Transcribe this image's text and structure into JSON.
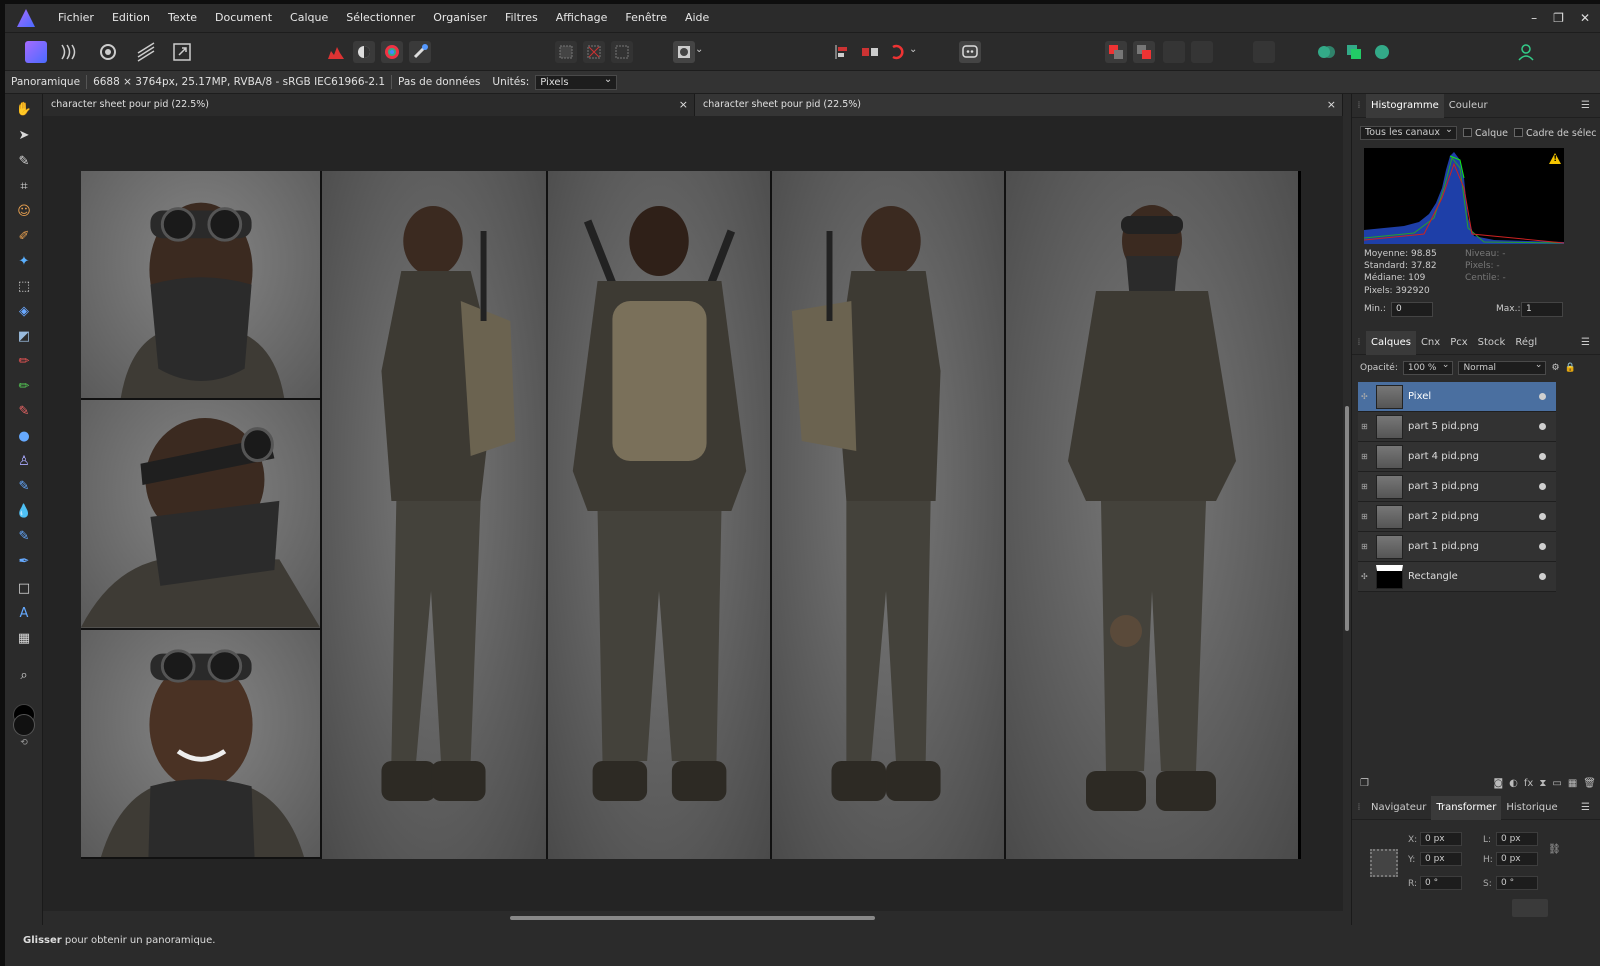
{
  "menu": [
    "Fichier",
    "Edition",
    "Texte",
    "Document",
    "Calque",
    "Sélectionner",
    "Organiser",
    "Filtres",
    "Affichage",
    "Fenêtre",
    "Aide"
  ],
  "window_controls": {
    "minimize": "–",
    "restore": "❐",
    "close": "✕"
  },
  "context": {
    "mode": "Panoramique",
    "doc_info": "6688 × 3764px, 25.17MP, RVBA/8 - sRGB IEC61966-2.1",
    "data_status": "Pas de données",
    "units_label": "Unités:",
    "units_value": "Pixels"
  },
  "tabs": [
    {
      "label": "character sheet pour pid (22.5%)",
      "close": "×"
    },
    {
      "label": "character sheet pour pid (22.5%)",
      "close": "×"
    }
  ],
  "histogram_panel": {
    "tabs": [
      "Histogramme",
      "Couleur"
    ],
    "channel": "Tous les canaux",
    "layer_label": "Calque",
    "selection_label": "Cadre de sélec",
    "warning_icon": "!",
    "stats_left": [
      "Moyenne: 98.85",
      "Standard: 37.82",
      "Médiane: 109",
      "Pixels: 392920"
    ],
    "stats_right": [
      "Niveau: -",
      "Pixels: -",
      "Centile: -"
    ],
    "min_label": "Min.:",
    "min_value": "0",
    "max_label": "Max.:",
    "max_value": "1"
  },
  "layers_panel": {
    "tabs": [
      "Calques",
      "Cnx",
      "Pcx",
      "Stock",
      "Régl"
    ],
    "opacity_label": "Opacité:",
    "opacity_value": "100 %",
    "blend_mode": "Normal",
    "layers": [
      {
        "name": "Pixel",
        "selected": true
      },
      {
        "name": "part 5 pid.png",
        "selected": false
      },
      {
        "name": "part 4 pid.png",
        "selected": false
      },
      {
        "name": "part 3 pid.png",
        "selected": false
      },
      {
        "name": "part 2 pid.png",
        "selected": false
      },
      {
        "name": "part 1 pid.png",
        "selected": false
      },
      {
        "name": "Rectangle",
        "selected": false
      }
    ]
  },
  "transform_panel": {
    "tabs": [
      "Navigateur",
      "Transformer",
      "Historique"
    ],
    "x_label": "X:",
    "x_value": "0 px",
    "y_label": "Y:",
    "y_value": "0 px",
    "w_label": "L:",
    "w_value": "0 px",
    "h_label": "H:",
    "h_value": "0 px",
    "r_label": "R:",
    "r_value": "0 °",
    "s_label": "S:",
    "s_value": "0 °"
  },
  "status": {
    "bold": "Glisser",
    "text": " pour obtenir un panoramique."
  },
  "colors": {
    "accent": "#4a6fa0",
    "background": "#2b2b2b",
    "canvas": "#242424"
  }
}
